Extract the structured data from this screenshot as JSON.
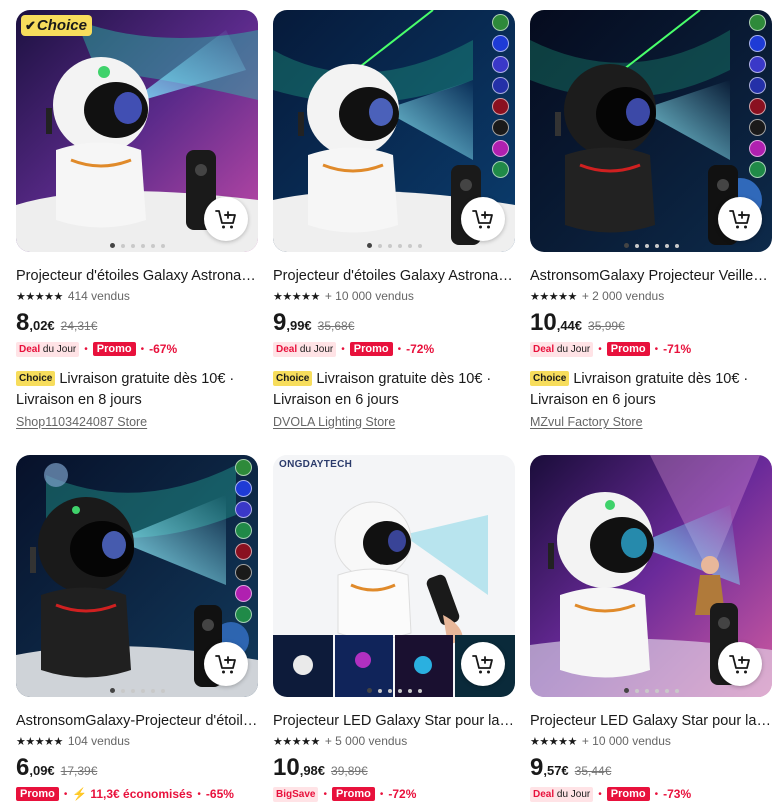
{
  "products": [
    {
      "title": "Projecteur d'étoiles Galaxy Astronaute LED",
      "sold": "414 vendus",
      "price_int": "8",
      "price_dec": ",02€",
      "price_old": "24,31€",
      "deal_label": "Deal",
      "deal_suffix": "du Jour",
      "promo_label": "Promo",
      "discount": "-67%",
      "choice_label": "Choice",
      "shipping": "Livraison gratuite dès 10€ · Livraison en 8 jours",
      "store": "Shop1103424087 Store",
      "image_badge": "Choice"
    },
    {
      "title": "Projecteur d'étoiles Galaxy Astronaute LED",
      "sold": "+ 10 000 vendus",
      "price_int": "9",
      "price_dec": ",99€",
      "price_old": "35,68€",
      "deal_label": "Deal",
      "deal_suffix": "du Jour",
      "promo_label": "Promo",
      "discount": "-72%",
      "choice_label": "Choice",
      "shipping": "Livraison gratuite dès 10€ · Livraison en 6 jours",
      "store": "DVOLA Lighting Store"
    },
    {
      "title": "AstronsomGalaxy Projecteur Veilleuse",
      "sold": "+ 2 000 vendus",
      "price_int": "10",
      "price_dec": ",44€",
      "price_old": "35,99€",
      "deal_label": "Deal",
      "deal_suffix": "du Jour",
      "promo_label": "Promo",
      "discount": "-71%",
      "choice_label": "Choice",
      "shipping": "Livraison gratuite dès 10€ · Livraison en 6 jours",
      "store": "MZvul Factory Store"
    },
    {
      "title": "AstronsomGalaxy-Projecteur d'étoiles",
      "sold": "104 vendus",
      "price_int": "6",
      "price_dec": ",09€",
      "price_old": "17,39€",
      "promo_label": "Promo",
      "savings": "11,3€ économisés",
      "discount": "-65%"
    },
    {
      "title": "Projecteur LED Galaxy Star pour la maison",
      "sold": "+ 5 000 vendus",
      "price_int": "10",
      "price_dec": ",98€",
      "price_old": "39,89€",
      "bigsave_label": "BigSave",
      "promo_label": "Promo",
      "discount": "-72%",
      "image_brand": "ONGDAYTECH"
    },
    {
      "title": "Projecteur LED Galaxy Star pour la maison",
      "sold": "+ 10 000 vendus",
      "price_int": "9",
      "price_dec": ",57€",
      "price_old": "35,44€",
      "deal_label": "Deal",
      "deal_suffix": "du Jour",
      "promo_label": "Promo",
      "discount": "-73%"
    }
  ],
  "colors": {
    "accent_red": "#e8113c",
    "choice_yellow": "#f7dd5c",
    "deal_bg": "#ffe3e6"
  },
  "icons": {
    "cart": "add-to-cart-icon",
    "star": "star-icon",
    "check": "check-icon",
    "bolt": "lightning-icon"
  }
}
